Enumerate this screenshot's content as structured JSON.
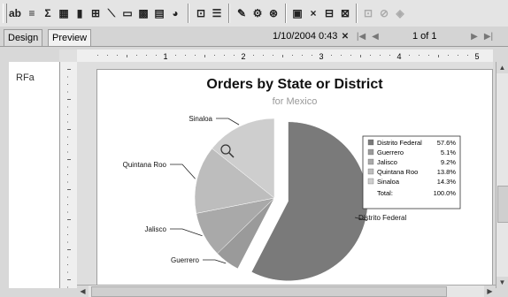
{
  "toolbar": {
    "buttons": [
      "ab",
      "≡",
      "Σ",
      "▦",
      "▮",
      "⊞",
      "⟍",
      "▭",
      "▩",
      "▤",
      "◕",
      "⊡",
      "☰",
      "✎",
      "⚙",
      "⊛",
      "▣",
      "×",
      "⊟",
      "⊠",
      "⊡",
      "⊘",
      "◈"
    ]
  },
  "tabs": {
    "design": "Design",
    "preview": "Preview"
  },
  "nav": {
    "datetime": "1/10/2004  0:43",
    "close": "✕",
    "page": "1 of 1"
  },
  "ruler": {
    "marks": [
      "1",
      "2",
      "3",
      "4",
      "5"
    ]
  },
  "left_panel": {
    "section_label": "RFa"
  },
  "chart_data": {
    "type": "pie",
    "title": "Orders by State or District",
    "subtitle": "for Mexico",
    "slices": [
      {
        "name": "Distrito Federal",
        "value": 57.6,
        "display": "57.6%",
        "color": "#7a7a7a",
        "exploded": true
      },
      {
        "name": "Guerrero",
        "value": 5.1,
        "display": "5.1%",
        "color": "#9a9a9a",
        "exploded": false
      },
      {
        "name": "Jalisco",
        "value": 9.2,
        "display": "9.2%",
        "color": "#a9a9a9",
        "exploded": false
      },
      {
        "name": "Quintana Roo",
        "value": 13.8,
        "display": "13.8%",
        "color": "#bdbdbd",
        "exploded": false
      },
      {
        "name": "Sinaloa",
        "value": 14.3,
        "display": "14.3%",
        "color": "#cecece",
        "exploded": false
      }
    ],
    "total_label": "Total:",
    "total_value": "100.0%",
    "legend_position": "right"
  }
}
